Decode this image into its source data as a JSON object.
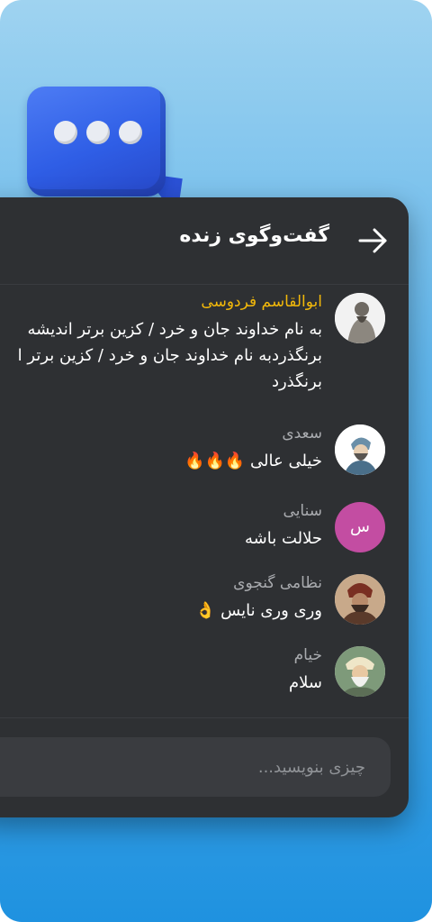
{
  "chat": {
    "title": "گفت‌وگوی زنده",
    "back_icon": "arrow-right-icon",
    "input_placeholder": "چیزی بنویسید...",
    "messages": [
      {
        "name": "ابوالقاسم فردوسی",
        "name_color": "#f2b80a",
        "lines": [
          "به نام خداوند جان و خرد / کزین برتر اندیشه",
          "برنگذردبه نام خداوند جان و خرد / کزین برتر ا",
          "برنگذرد"
        ]
      },
      {
        "name": "سعدی",
        "text": "خیلی عالی",
        "emoji": "🔥🔥🔥"
      },
      {
        "name": "سنایی",
        "avatar_letter": "س",
        "avatar_color": "#c34da2",
        "text": "حلالت باشه"
      },
      {
        "name": "نظامی گنجوی",
        "text": "وری وری نایس",
        "emoji": "👌"
      },
      {
        "name": "خیام",
        "text": "سلام"
      }
    ]
  },
  "colors": {
    "panel": "#2e3033",
    "accent_blue": "#2f5ee6",
    "background_top": "#9fd3f0",
    "background_bottom": "#1f92e0"
  }
}
